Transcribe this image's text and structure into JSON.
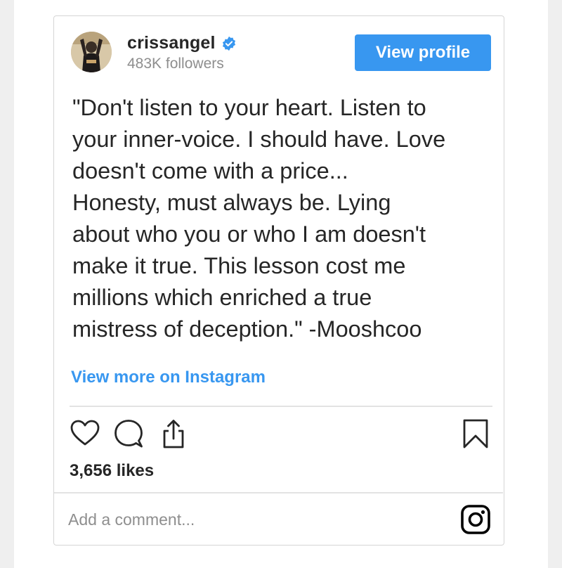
{
  "post": {
    "username": "crissangel",
    "followers": "483K followers",
    "view_profile_label": "View profile",
    "quote_text": "\"Don't listen to your heart. Listen to\nyour inner-voice. I should have. Love\ndoesn't come with a price...\nHonesty, must always be.  Lying\nabout who you or who I am doesn't\nmake it true. This lesson cost me\nmillions which enriched a true\nmistress of deception.\" -Mooshcoo",
    "view_more_label": "View more on Instagram",
    "likes": "3,656 likes",
    "comment_placeholder": "Add a comment..."
  },
  "icons": {
    "verified": "verified-badge-icon",
    "like": "heart-icon",
    "comment": "comment-icon",
    "share": "share-icon",
    "save": "bookmark-icon",
    "instagram": "instagram-logo-icon"
  },
  "colors": {
    "accent": "#3897f0",
    "text": "#262626",
    "muted": "#8e8e8e",
    "border": "#d5d5d5"
  }
}
